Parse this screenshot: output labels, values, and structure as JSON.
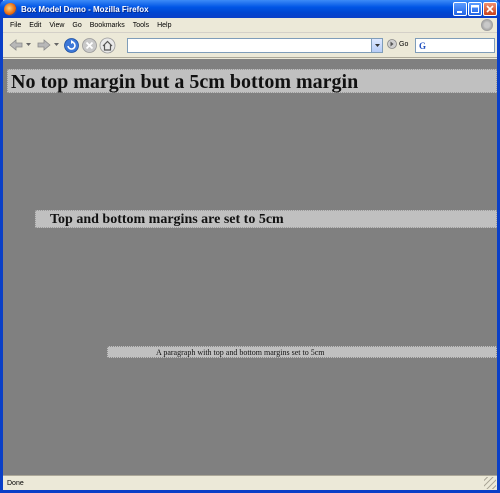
{
  "window": {
    "title": "Box Model Demo - Mozilla Firefox"
  },
  "menu": {
    "items": [
      "File",
      "Edit",
      "View",
      "Go",
      "Bookmarks",
      "Tools",
      "Help"
    ]
  },
  "toolbar": {
    "url_value": "",
    "go_label": "Go",
    "search_value": ""
  },
  "page": {
    "heading1": "No top margin but a 5cm bottom margin",
    "heading2": "Top and bottom margins are set to 5cm",
    "paragraph": "A paragraph with top and bottom margins set to 5cm"
  },
  "status": {
    "text": "Done"
  },
  "colors": {
    "page_background": "#808080",
    "box_background": "#c0c0c0",
    "titlebar": "#0055e5"
  }
}
